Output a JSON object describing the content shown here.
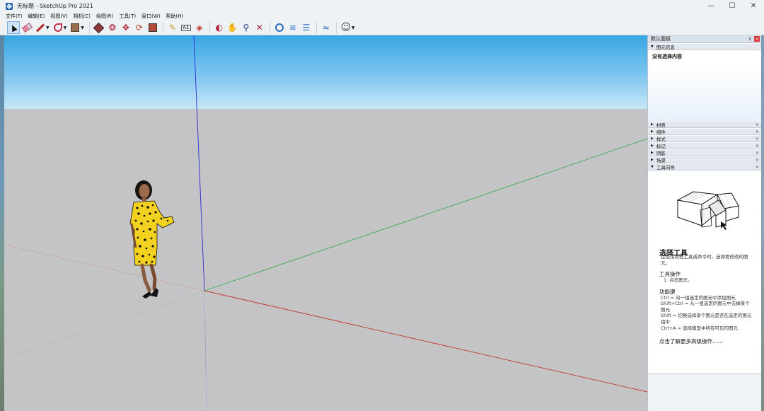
{
  "window": {
    "title": "无标题 - SketchUp Pro 2021",
    "controls": [
      "—",
      "☐",
      "✕"
    ]
  },
  "menu": [
    "文件(F)",
    "编辑(E)",
    "视图(V)",
    "相机(C)",
    "绘图(R)",
    "工具(T)",
    "窗口(W)",
    "帮助(H)"
  ],
  "toolbar": {
    "groups": [
      [
        "select-arrow",
        "eraser",
        "pencil",
        "shapes",
        "rectangle"
      ],
      [
        "push-pull",
        "follow-me",
        "move",
        "rotate",
        "scale"
      ],
      [
        "tape-measure",
        "text",
        "paint-bucket"
      ],
      [
        "orbit",
        "pan",
        "zoom",
        "zoom-extents"
      ],
      [
        "3d-warehouse",
        "extension-warehouse",
        "layout"
      ],
      [
        "sandbox"
      ],
      [
        "account"
      ]
    ]
  },
  "panel": {
    "title": "默认面板",
    "pin": "⇕",
    "close": "×",
    "entity_info": {
      "label": "图元信息",
      "content": "没有选择内容"
    },
    "sections": [
      "材质",
      "组件",
      "样式",
      "标记",
      "阴影",
      "场景"
    ],
    "instructor": {
      "label": "工具向导",
      "title": "选择工具",
      "description": "在使用其他工具或命令时，选择要修改的图元。",
      "ops_heading": "工具操作",
      "ops": [
        "1. 点击图元。"
      ],
      "keys_heading": "功能键",
      "keys": [
        "Ctrl = 向一组选定的图元中添加图元",
        "Shift+Ctrl = 从一组选定的图元中去掉某个图元",
        "Shift = 切换选择某个图元是否在选定的图元组中",
        "Ctrl+A = 选择模型中所有可见的图元"
      ],
      "more_link": "点击了解更多高级操作……"
    }
  },
  "colors": {
    "sky_top": "#38a6e4",
    "ground": "#c4c4c7",
    "axis_red": "#c0392b",
    "axis_green": "#3aa84a",
    "axis_blue": "#2b2bd0"
  }
}
